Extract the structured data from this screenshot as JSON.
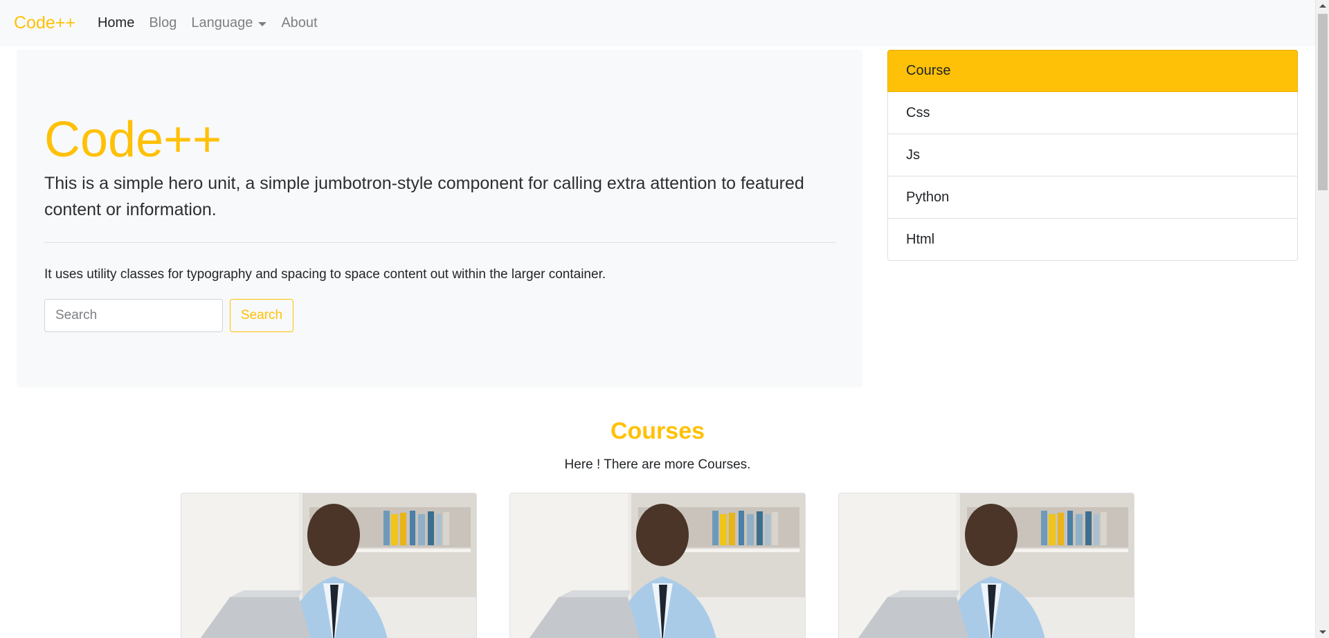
{
  "navbar": {
    "brand": "Code++",
    "links": [
      {
        "label": "Home",
        "active": true
      },
      {
        "label": "Blog",
        "active": false
      },
      {
        "label": "Language",
        "active": false,
        "dropdown": true
      },
      {
        "label": "About",
        "active": false
      }
    ]
  },
  "hero": {
    "title": "Code++",
    "lead": "This is a simple hero unit, a simple jumbotron-style component for calling extra attention to featured content or information.",
    "text": "It uses utility classes for typography and spacing to space content out within the larger container.",
    "search_placeholder": "Search",
    "search_button": "Search"
  },
  "sidebar": {
    "items": [
      "Course",
      "Css",
      "Js",
      "Python",
      "Html"
    ]
  },
  "courses": {
    "title": "Courses",
    "subtitle": "Here ! There are more Courses.",
    "cards": [
      {
        "image": "man-with-laptop"
      },
      {
        "image": "man-with-laptop"
      },
      {
        "image": "man-with-laptop"
      }
    ]
  },
  "colors": {
    "accent": "#ffc107",
    "light_bg": "#f8f9fa"
  }
}
